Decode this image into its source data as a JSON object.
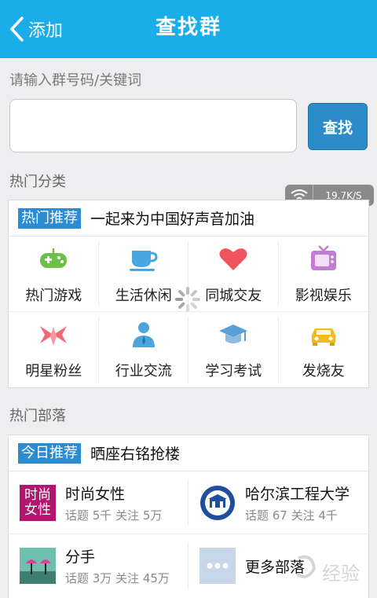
{
  "header": {
    "back_label": "添加",
    "title": "查找群"
  },
  "search": {
    "label": "请输入群号码/关键词",
    "placeholder": "",
    "value": "",
    "button_label": "查找"
  },
  "status": {
    "net_speed": "19.7K/S"
  },
  "hot_categories": {
    "section_title": "热门分类",
    "tag": "热门推荐",
    "headline": "一起来为中国好声音加油",
    "items": [
      {
        "label": "热门游戏",
        "icon": "gamepad-icon"
      },
      {
        "label": "生活休闲",
        "icon": "coffee-cup-icon"
      },
      {
        "label": "同城交友",
        "icon": "heart-icon"
      },
      {
        "label": "影视娱乐",
        "icon": "tv-icon"
      },
      {
        "label": "明星粉丝",
        "icon": "star-bow-icon"
      },
      {
        "label": "行业交流",
        "icon": "businessman-icon"
      },
      {
        "label": "学习考试",
        "icon": "graduation-cap-icon"
      },
      {
        "label": "发烧友",
        "icon": "car-icon"
      }
    ],
    "colors": {
      "green": "#6cc04a",
      "blue": "#4ba6df",
      "red": "#f0545e",
      "purple": "#c47bd2",
      "pink": "#f06a78",
      "gold": "#f2bb1a"
    }
  },
  "hot_tribes": {
    "section_title": "热门部落",
    "tag": "今日推荐",
    "headline": "晒座右铭抢楼",
    "items": [
      {
        "name": "时尚女性",
        "stats": "话题 5千 关注 5万",
        "thumb_text": "时尚女性"
      },
      {
        "name": "哈尔滨工程大学",
        "stats": "话题 67 关注 4千"
      },
      {
        "name": "分手",
        "stats": "话题 3万 关注 45万"
      },
      {
        "name": "更多部落"
      }
    ]
  },
  "watermark": {
    "text": "经验"
  },
  "accent": "#19aee9"
}
